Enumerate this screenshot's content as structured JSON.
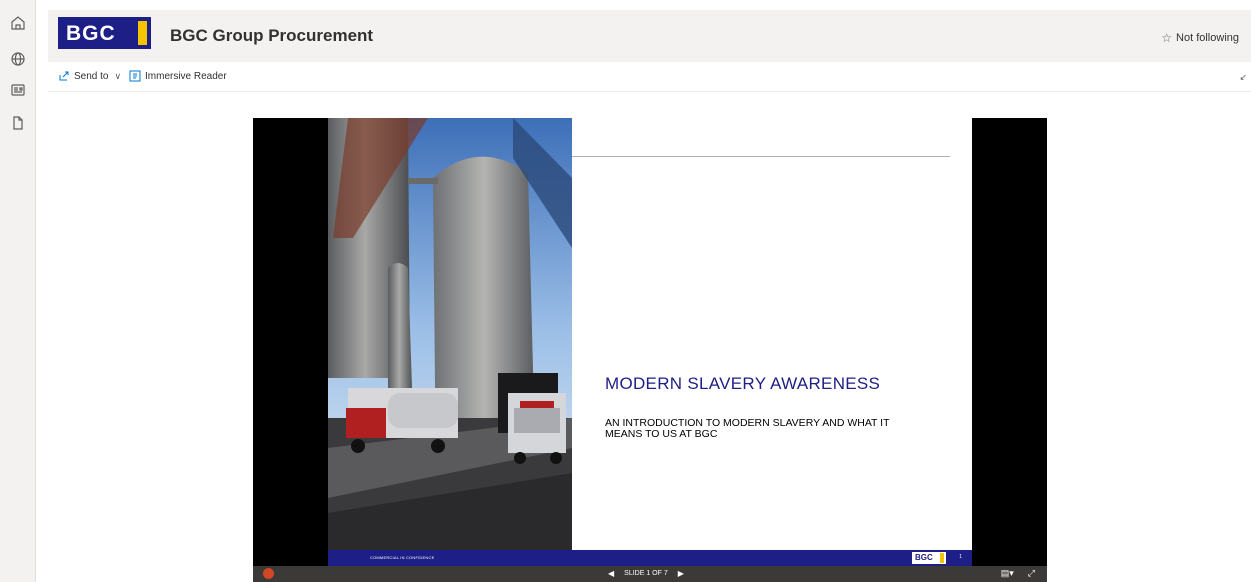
{
  "rail": {
    "icons": [
      "home-icon",
      "globe-icon",
      "news-icon",
      "document-icon"
    ]
  },
  "header": {
    "logo_text": "BGC",
    "site_title": "BGC Group Procurement",
    "follow_label": "Not following",
    "follow_icon": "star-icon"
  },
  "commandbar": {
    "send_to_label": "Send to",
    "immersive_reader_label": "Immersive Reader"
  },
  "slide": {
    "title": "MODERN SLAVERY AWARENESS",
    "subtitle": "AN INTRODUCTION TO MODERN SLAVERY AND WHAT IT MEANS TO US AT BGC",
    "footer_confidential": "COMMERCIAL IN CONFIDENCE",
    "footer_logo": "BGC",
    "footer_page": "1"
  },
  "player": {
    "slide_indicator": "SLIDE 1 OF 7"
  },
  "colors": {
    "brand_blue": "#1e1e87",
    "brand_yellow": "#f5c400"
  }
}
